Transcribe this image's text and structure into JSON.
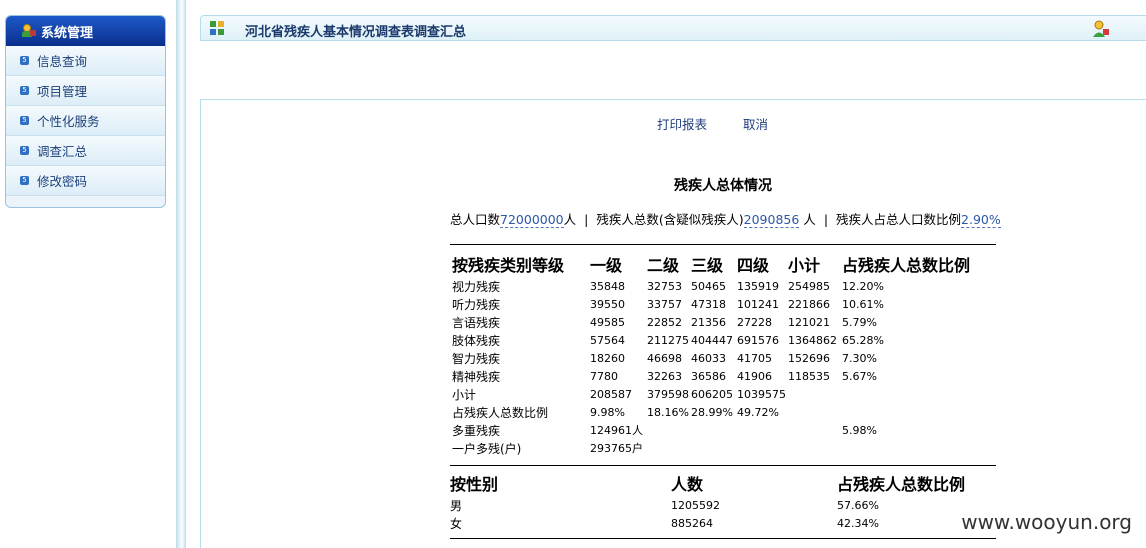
{
  "sidebar": {
    "title": "系统管理",
    "items": [
      {
        "label": "信息查询"
      },
      {
        "label": "项目管理"
      },
      {
        "label": "个性化服务"
      },
      {
        "label": "调查汇总"
      },
      {
        "label": "修改密码"
      }
    ]
  },
  "header": {
    "title": "河北省残疾人基本情况调查表调查汇总"
  },
  "actions": {
    "print": "打印报表",
    "cancel": "取消"
  },
  "report": {
    "title": "残疾人总体情况",
    "summary": {
      "total_pop_label": "总人口数",
      "total_pop_value": "72000000",
      "total_pop_unit": "人",
      "disabled_label": "残疾人总数(含疑似残疾人)",
      "disabled_value": "2090856",
      "disabled_unit": "人",
      "ratio_label": "残疾人占总人口数比例",
      "ratio_value": "2.90%",
      "separator": "|"
    },
    "by_type": {
      "headers": [
        "按残疾类别等级",
        "一级",
        "二级",
        "三级",
        "四级",
        "小计",
        "占残疾人总数比例"
      ],
      "rows": [
        [
          "视力残疾",
          "35848",
          "32753",
          "50465",
          "135919",
          "254985",
          "12.20%"
        ],
        [
          "听力残疾",
          "39550",
          "33757",
          "47318",
          "101241",
          "221866",
          "10.61%"
        ],
        [
          "言语残疾",
          "49585",
          "22852",
          "21356",
          "27228",
          "121021",
          "5.79%"
        ],
        [
          "肢体残疾",
          "57564",
          "211275",
          "404447",
          "691576",
          "1364862",
          "65.28%"
        ],
        [
          "智力残疾",
          "18260",
          "46698",
          "46033",
          "41705",
          "152696",
          "7.30%"
        ],
        [
          "精神残疾",
          "7780",
          "32263",
          "36586",
          "41906",
          "118535",
          "5.67%"
        ],
        [
          "小计",
          "208587",
          "379598",
          "606205",
          "1039575",
          "",
          ""
        ],
        [
          "占残疾人总数比例",
          "9.98%",
          "18.16%",
          "28.99%",
          "49.72%",
          "",
          ""
        ],
        [
          "多重残疾",
          "124961人",
          "",
          "",
          "",
          "",
          "5.98%"
        ],
        [
          "一户多残(户)",
          "293765户",
          "",
          "",
          "",
          "",
          ""
        ]
      ]
    },
    "by_gender": {
      "headers": [
        "按性别",
        "人数",
        "占残疾人总数比例"
      ],
      "rows": [
        [
          "男",
          "1205592",
          "57.66%"
        ],
        [
          "女",
          "885264",
          "42.34%"
        ]
      ]
    }
  },
  "watermark": "www.wooyun.org",
  "colors": {
    "sidebar_header": "#0a2f8c",
    "link": "#1f3e7c",
    "value": "#2a57a8"
  }
}
